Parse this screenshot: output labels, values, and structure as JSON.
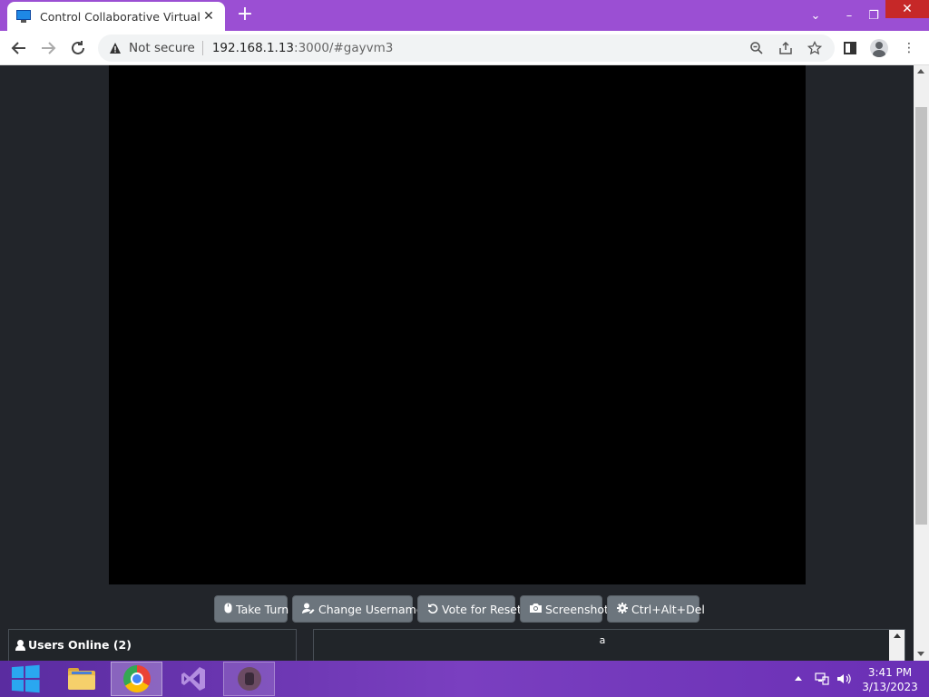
{
  "browser": {
    "tab_title": "Control Collaborative Virtual Mac",
    "new_tab_glyph": "+",
    "security_label": "Not secure",
    "url_host": "192.168.1.13",
    "url_rest": ":3000/#gayvm3",
    "window_controls": {
      "dropdown": "⌄",
      "minimize": "–",
      "restore": "❐",
      "close": "✕"
    }
  },
  "vm": {
    "buttons": [
      {
        "label": "Take Turn",
        "icon": "mouse-icon"
      },
      {
        "label": "Change Username",
        "icon": "user-edit-icon"
      },
      {
        "label": "Vote for Reset",
        "icon": "rotate-left-icon"
      },
      {
        "label": "Screenshot",
        "icon": "camera-icon"
      },
      {
        "label": "Ctrl+Alt+Del",
        "icon": "gear-icon"
      }
    ],
    "users_online_label": "Users Online (2)",
    "chat_text": "a"
  },
  "taskbar": {
    "apps": [
      "windows-start-icon",
      "file-explorer-icon",
      "chrome-icon",
      "visual-studio-icon",
      "virtual-machine-icon"
    ],
    "time": "3:41 PM",
    "date": "3/13/2023"
  },
  "colors": {
    "tabstrip": "#9b4fd3",
    "page_bg": "#22252a",
    "button_bg": "#6c757d",
    "taskbar": "#6a2fb5"
  }
}
